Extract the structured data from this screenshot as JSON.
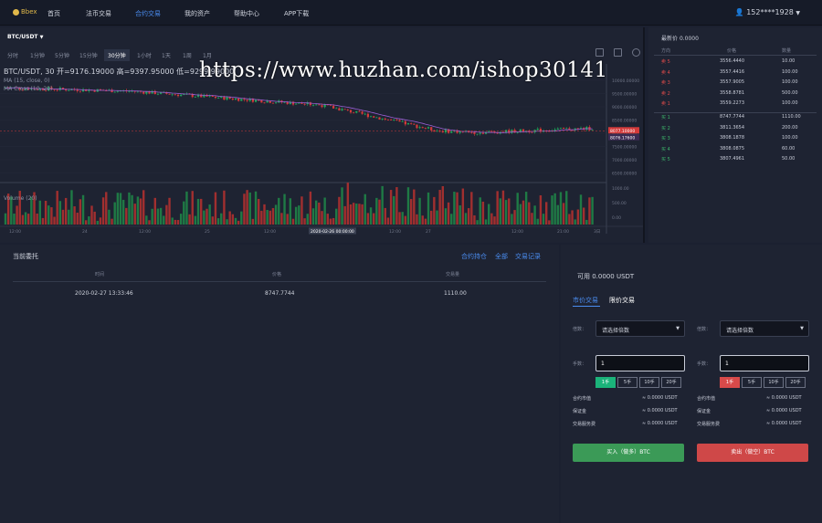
{
  "nav": {
    "logo": "Bbex",
    "items": [
      "首页",
      "法币交易",
      "合约交易",
      "我的资产",
      "帮助中心",
      "APP下载"
    ],
    "active_index": 2,
    "user": "152****1928"
  },
  "chart": {
    "pair": "BTC/USDT",
    "timeframes": [
      "分时",
      "1分钟",
      "5分钟",
      "15分钟",
      "30分钟",
      "1小时",
      "1天",
      "1周",
      "1月"
    ],
    "active_timeframe": "30分钟",
    "legend_main": "BTC/USDT, 30  开=9176.19000  高=9397.95000  低=9299.99000",
    "legend_ma1": "MA (15, close, 0)",
    "legend_ma2": "MA Cross (10, 20)",
    "legend_volume": "Volume (20)",
    "price_labels": [
      "10000.00000",
      "9500.00000",
      "9000.00000",
      "8500.00000",
      "8000.00000",
      "7500.00000",
      "7000.00000",
      "6500.00000"
    ],
    "price_tag_current": "8077.10000",
    "price_tag_ma": "8076.17600",
    "volume_labels": [
      "1000.00",
      "500.00",
      "0.00"
    ],
    "time_labels": [
      "12:00",
      "24",
      "12:00",
      "25",
      "12:00",
      "2020-02-26 00:00:00",
      "12:00",
      "27",
      "12:00",
      "21:00",
      "3日"
    ],
    "price_series_colors": {
      "up": "#1fa35a",
      "down": "#d33a3a",
      "ma": "#9c5fd6",
      "ma_alt": "#e05a5a"
    }
  },
  "watermark": "https://www.huzhan.com/ishop30141",
  "orderbook": {
    "latest_label": "最新价",
    "latest_value": "0.0000",
    "headers": [
      "方向",
      "价格",
      "数量"
    ],
    "asks": [
      {
        "side": "卖 5",
        "price": "3556.4440",
        "qty": "10.00"
      },
      {
        "side": "卖 4",
        "price": "3557.4416",
        "qty": "100.00"
      },
      {
        "side": "卖 3",
        "price": "3557.9005",
        "qty": "100.00"
      },
      {
        "side": "卖 2",
        "price": "3558.8781",
        "qty": "500.00"
      },
      {
        "side": "卖 1",
        "price": "3559.2273",
        "qty": "100.00"
      }
    ],
    "bids": [
      {
        "side": "买 1",
        "price": "8747.7744",
        "qty": "1110.00"
      },
      {
        "side": "买 2",
        "price": "3811.3654",
        "qty": "200.00"
      },
      {
        "side": "买 3",
        "price": "3808.1878",
        "qty": "100.00"
      },
      {
        "side": "买 4",
        "price": "3808.0875",
        "qty": "60.00"
      },
      {
        "side": "买 5",
        "price": "3807.4961",
        "qty": "50.00"
      }
    ],
    "ask_color": "#d84a4a",
    "bid_color": "#3cb36a"
  },
  "orders": {
    "title": "当前委托",
    "links": [
      "合约持仓",
      "全部",
      "交易记录"
    ],
    "headers": [
      "时间",
      "价格",
      "交易量"
    ],
    "rows": [
      {
        "time": "2020-02-27 13:33:46",
        "price": "8747.7744",
        "volume": "1110.00"
      }
    ]
  },
  "trade": {
    "available": "可用 0.0000 USDT",
    "tabs": [
      "市价交易",
      "限价交易"
    ],
    "buy": {
      "multiple_label": "倍数：",
      "multiple_placeholder": "请选择倍数",
      "qty_label": "手数：",
      "qty_value": "1",
      "lots": [
        "1手",
        "5手",
        "10手",
        "20手"
      ],
      "info": [
        {
          "label": "合约市值",
          "value": "≈ 0.0000 USDT"
        },
        {
          "label": "保证金",
          "value": "≈ 0.0000 USDT"
        },
        {
          "label": "交易服务费",
          "value": "≈ 0.0000 USDT"
        }
      ],
      "button": "买入（做多）BTC"
    },
    "sell": {
      "multiple_label": "倍数：",
      "multiple_placeholder": "请选择倍数",
      "qty_label": "手数：",
      "qty_value": "1",
      "lots": [
        "1手",
        "5手",
        "10手",
        "20手"
      ],
      "info": [
        {
          "label": "合约市值",
          "value": "≈ 0.0000 USDT"
        },
        {
          "label": "保证金",
          "value": "≈ 0.0000 USDT"
        },
        {
          "label": "交易服务费",
          "value": "≈ 0.0000 USDT"
        }
      ],
      "button": "卖出（做空）BTC"
    }
  }
}
